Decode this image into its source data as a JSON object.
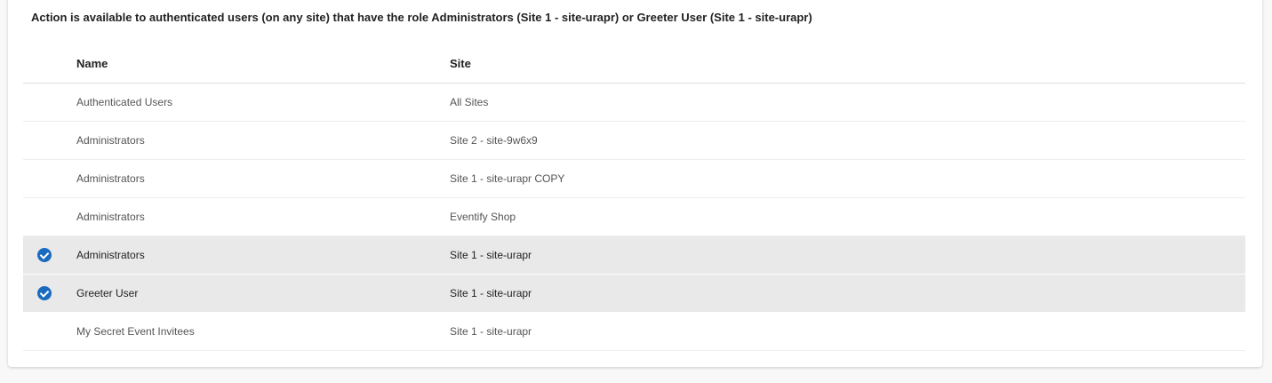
{
  "description": "Action is available to authenticated users (on any site) that have the role Administrators (Site 1 - site-urapr) or Greeter User (Site 1 - site-urapr)",
  "table": {
    "headers": {
      "name": "Name",
      "site": "Site"
    },
    "rows": [
      {
        "name": "Authenticated Users",
        "site": "All Sites",
        "selected": false
      },
      {
        "name": "Administrators",
        "site": "Site 2 - site-9w6x9",
        "selected": false
      },
      {
        "name": "Administrators",
        "site": "Site 1 - site-urapr COPY",
        "selected": false
      },
      {
        "name": "Administrators",
        "site": "Eventify Shop",
        "selected": false
      },
      {
        "name": "Administrators",
        "site": "Site 1 - site-urapr",
        "selected": true
      },
      {
        "name": "Greeter User",
        "site": "Site 1 - site-urapr",
        "selected": true
      },
      {
        "name": "My Secret Event Invitees",
        "site": "Site 1 - site-urapr",
        "selected": false
      }
    ]
  },
  "colors": {
    "check": "#1a6bbf",
    "selected_row": "#e9e9e9"
  }
}
